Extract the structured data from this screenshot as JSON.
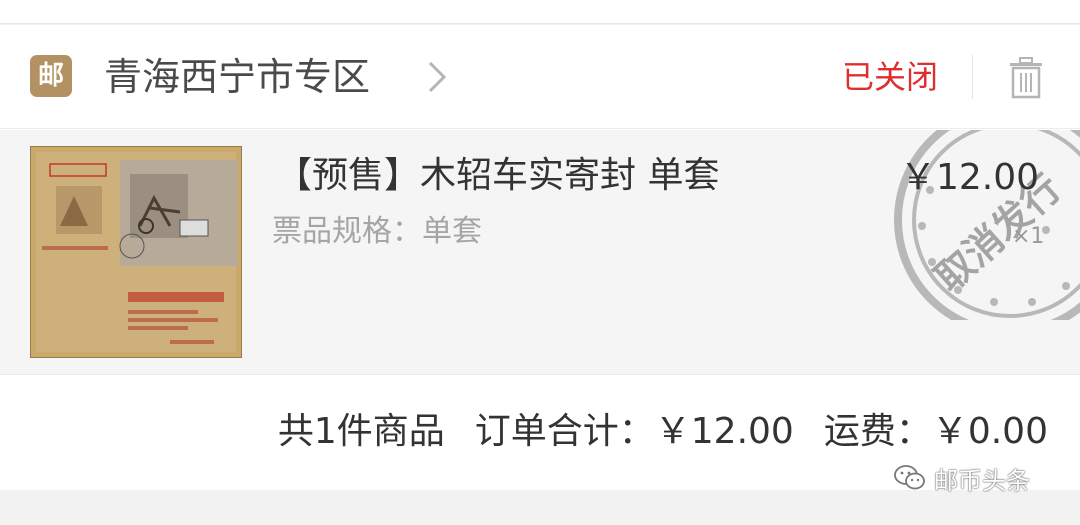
{
  "shop": {
    "icon_text": "邮",
    "name": "青海西宁市专区"
  },
  "order": {
    "status": "已关闭"
  },
  "item": {
    "title": "【预售】木轺车实寄封 单套",
    "spec": "票品规格：单套",
    "price": "￥12.00",
    "qty": "×1",
    "stamp_text": "取消发行"
  },
  "summary": {
    "count": "共1件商品",
    "total": "订单合计：￥12.00",
    "shipping": "运费：￥0.00"
  },
  "watermark": {
    "text": "邮币头条"
  },
  "colors": {
    "status_red": "#e02e2e",
    "shop_icon_bg": "#b39162"
  }
}
